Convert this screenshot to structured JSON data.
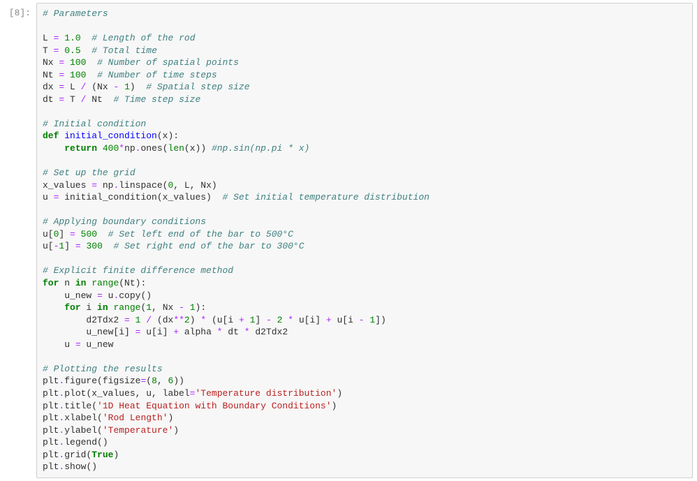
{
  "cell": {
    "prompt": "[8]:",
    "code": {
      "l1_comment": "# Parameters",
      "l3_var": "L",
      "l3_op": "=",
      "l3_num": "1.0",
      "l3_comment": "# Length of the rod",
      "l4_var": "T",
      "l4_op": "=",
      "l4_num": "0.5",
      "l4_comment": "# Total time",
      "l5_var": "Nx",
      "l5_op": "=",
      "l5_num": "100",
      "l5_comment": "# Number of spatial points",
      "l6_var": "Nt",
      "l6_op": "=",
      "l6_num": "100",
      "l6_comment": "# Number of time steps",
      "l7_lhs": "dx ",
      "l7_eq": "=",
      "l7_rhs1": " L ",
      "l7_div": "/",
      "l7_rhs2": " (Nx ",
      "l7_minus": "-",
      "l7_rhs3": " ",
      "l7_one": "1",
      "l7_close": ")  ",
      "l7_comment": "# Spatial step size",
      "l8_lhs": "dt ",
      "l8_eq": "=",
      "l8_rhs1": " T ",
      "l8_div": "/",
      "l8_rhs2": " Nt  ",
      "l8_comment": "# Time step size",
      "l10_comment": "# Initial condition",
      "l11_def": "def",
      "l11_name": " initial_condition",
      "l11_args": "(x):",
      "l12_return": "return",
      "l12_space": " ",
      "l12_num": "400",
      "l12_star": "*",
      "l12_np": "np",
      "l12_dot": ".",
      "l12_ones": "ones",
      "l12_open": "(",
      "l12_len": "len",
      "l12_x": "(x)) ",
      "l12_comment": "#np.sin(np.pi * x)",
      "l14_comment": "# Set up the grid",
      "l15_var": "x_values ",
      "l15_eq": "=",
      "l15_rhs": " np",
      "l15_dot": ".",
      "l15_linspace": "linspace",
      "l15_args_open": "(",
      "l15_zero": "0",
      "l15_c1": ", L, Nx)",
      "l16_var": "u ",
      "l16_eq": "=",
      "l16_rhs": " initial_condition(x_values)  ",
      "l16_comment": "# Set initial temperature distribution",
      "l18_comment": "# Applying boundary conditions",
      "l19_u": "u[",
      "l19_idx": "0",
      "l19_close": "] ",
      "l19_eq": "=",
      "l19_sp": " ",
      "l19_val": "500",
      "l19_sp2": "  ",
      "l19_comment": "# Set left end of the bar to 500°C",
      "l20_u": "u[",
      "l20_minus": "-",
      "l20_idx": "1",
      "l20_close": "] ",
      "l20_eq": "=",
      "l20_sp": " ",
      "l20_val": "300",
      "l20_sp2": "  ",
      "l20_comment": "# Set right end of the bar to 300°C",
      "l22_comment": "# Explicit finite difference method",
      "l23_for": "for",
      "l23_var": " n ",
      "l23_in": "in",
      "l23_sp": " ",
      "l23_range": "range",
      "l23_args": "(Nt):",
      "l24_lhs": "    u_new ",
      "l24_eq": "=",
      "l24_rhs": " u",
      "l24_dot": ".",
      "l24_copy": "copy",
      "l24_p": "()",
      "l25_indent": "    ",
      "l25_for": "for",
      "l25_var": " i ",
      "l25_in": "in",
      "l25_sp": " ",
      "l25_range": "range",
      "l25_open": "(",
      "l25_one": "1",
      "l25_c": ", Nx ",
      "l25_minus": "-",
      "l25_sp2": " ",
      "l25_one2": "1",
      "l25_close": "):",
      "l26_indent": "        d2Tdx2 ",
      "l26_eq": "=",
      "l26_sp": " ",
      "l26_one": "1",
      "l26_sp2": " ",
      "l26_div": "/",
      "l26_sp3": " (dx",
      "l26_pow": "**",
      "l26_two": "2",
      "l26_sp4": ") ",
      "l26_mul": "*",
      "l26_sp5": " (u[i ",
      "l26_plus": "+",
      "l26_sp6": " ",
      "l26_one2": "1",
      "l26_sp7": "] ",
      "l26_minus": "-",
      "l26_sp8": " ",
      "l26_two2": "2",
      "l26_sp9": " ",
      "l26_mul2": "*",
      "l26_sp10": " u[i] ",
      "l26_plus2": "+",
      "l26_sp11": " u[i ",
      "l26_minus2": "-",
      "l26_sp12": " ",
      "l26_one3": "1",
      "l26_close": "])",
      "l27_indent": "        u_new[i] ",
      "l27_eq": "=",
      "l27_rhs1": " u[i] ",
      "l27_plus": "+",
      "l27_rhs2": " alpha ",
      "l27_mul": "*",
      "l27_rhs3": " dt ",
      "l27_mul2": "*",
      "l27_rhs4": " d2Tdx2",
      "l28_lhs": "    u ",
      "l28_eq": "=",
      "l28_rhs": " u_new",
      "l30_comment": "# Plotting the results",
      "l31_plt": "plt",
      "l31_dot": ".",
      "l31_fn": "figure",
      "l31_open": "(figsize",
      "l31_eq": "=",
      "l31_p": "(",
      "l31_n1": "8",
      "l31_c": ", ",
      "l31_n2": "6",
      "l31_close": "))",
      "l32_plt": "plt",
      "l32_dot": ".",
      "l32_fn": "plot",
      "l32_args1": "(x_values, u, label",
      "l32_eq": "=",
      "l32_str": "'Temperature distribution'",
      "l32_close": ")",
      "l33_plt": "plt",
      "l33_dot": ".",
      "l33_fn": "title",
      "l33_open": "(",
      "l33_str": "'1D Heat Equation with Boundary Conditions'",
      "l33_close": ")",
      "l34_plt": "plt",
      "l34_dot": ".",
      "l34_fn": "xlabel",
      "l34_open": "(",
      "l34_str": "'Rod Length'",
      "l34_close": ")",
      "l35_plt": "plt",
      "l35_dot": ".",
      "l35_fn": "ylabel",
      "l35_open": "(",
      "l35_str": "'Temperature'",
      "l35_close": ")",
      "l36_plt": "plt",
      "l36_dot": ".",
      "l36_fn": "legend",
      "l36_args": "()",
      "l37_plt": "plt",
      "l37_dot": ".",
      "l37_fn": "grid",
      "l37_open": "(",
      "l37_true": "True",
      "l37_close": ")",
      "l38_plt": "plt",
      "l38_dot": ".",
      "l38_fn": "show",
      "l38_args": "()"
    }
  }
}
